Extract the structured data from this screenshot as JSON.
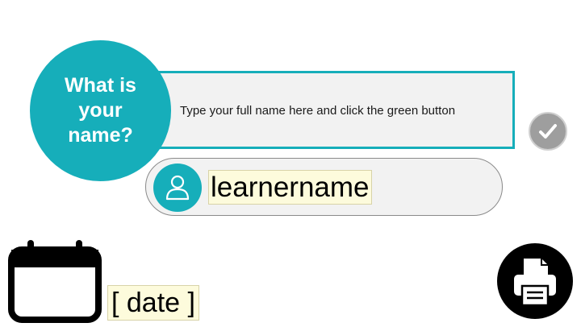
{
  "question": {
    "line1": "What is",
    "line2": "your",
    "line3": "name?"
  },
  "instruction": "Type your full name here and click the green button",
  "learner": {
    "name": "learnername"
  },
  "date": {
    "text": "[ date ]"
  },
  "icons": {
    "check": "checkmark-icon",
    "user": "user-icon",
    "calendar": "calendar-icon",
    "print": "printer-icon"
  },
  "colors": {
    "accent": "#16aeba",
    "panel": "#f2f2f2",
    "field_highlight": "#fdfbdc",
    "check_button": "#9e9e9e"
  }
}
